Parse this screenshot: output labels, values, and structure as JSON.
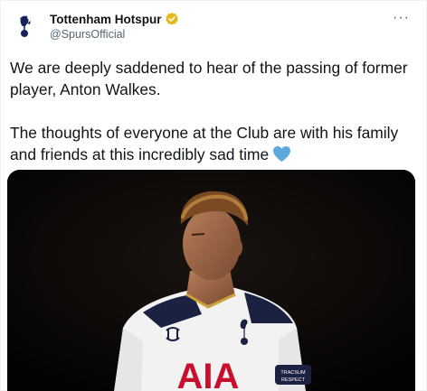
{
  "author": {
    "display_name": "Tottenham Hotspur",
    "handle": "@SpursOfficial",
    "verified_badge": "gold-verified-badge-icon",
    "avatar": "spurs-cockerel-crest-icon"
  },
  "menu_icon": "more-options-icon",
  "tweet": {
    "paragraph_1": "We are deeply saddened to hear of the passing of former player, Anton Walkes.",
    "paragraph_2": "The thoughts of everyone at the Club are with his family and friends at this incredibly sad time",
    "emoji": "blue-heart-emoji"
  },
  "media": {
    "kit_sponsor": "AIA",
    "armband_text": "TRACSUM RESPECT"
  },
  "colors": {
    "text": "#0f1419",
    "secondary": "#536471",
    "verified_gold": "#e2b719",
    "heart_blue": "#5da9dd"
  }
}
